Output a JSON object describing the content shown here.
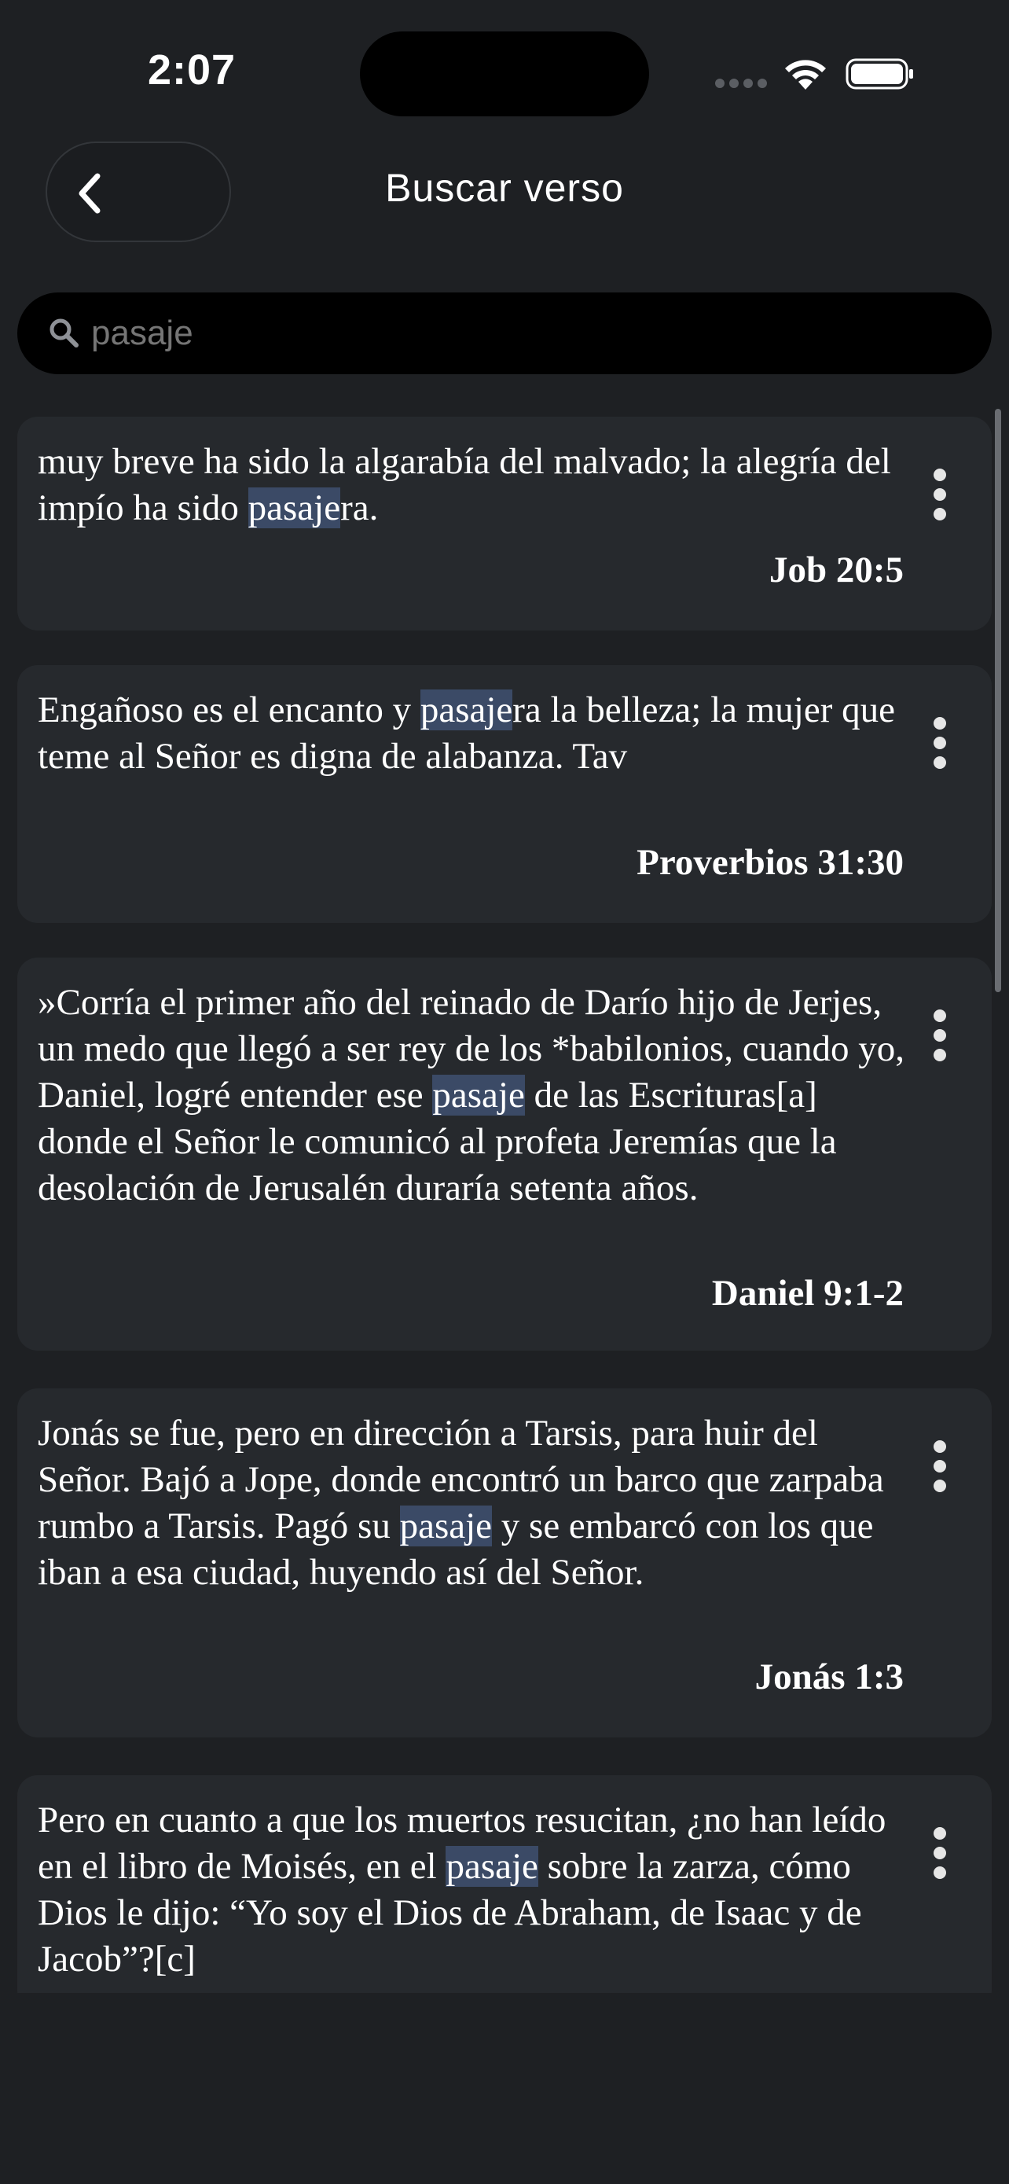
{
  "status_bar": {
    "time": "2:07"
  },
  "header": {
    "title": "Buscar verso"
  },
  "search": {
    "value": "",
    "placeholder": "pasaje"
  },
  "colors": {
    "background": "#1e2023",
    "card": "#26292d",
    "highlight": "#3b4a66",
    "search_bg": "#000000"
  },
  "icons": {
    "back": "chevron-left-icon",
    "search": "magnifier-icon",
    "more": "vertical-ellipsis-icon"
  },
  "results": [
    {
      "before": "muy breve ha sido la algarabía del malvado;    la alegría del impío ha sido ",
      "match": "pasaje",
      "after": "ra.",
      "reference": "Job 20:5"
    },
    {
      "before": "Engañoso es el encanto y ",
      "match": "pasaje",
      "after": "ra la belleza;    la mujer que teme al Señor es digna de alabanza. Tav",
      "reference": "Proverbios 31:30"
    },
    {
      "before": "»Corría el primer año del reinado de Darío hijo de Jerjes, un medo que llegó a ser rey de los *babilonios, cuando yo, Daniel, logré entender ese ",
      "match": "pasaje",
      "after": " de las Escrituras[a] donde el Señor le comunicó al profeta Jeremías que la desolación de Jerusalén duraría setenta años.",
      "reference": "Daniel 9:1-2"
    },
    {
      "before": "Jonás se fue, pero en dirección a Tarsis, para huir del Señor. Bajó a Jope, donde encontró un barco que zarpaba rumbo a Tarsis. Pagó su ",
      "match": "pasaje",
      "after": " y se embarcó con los que iban a esa ciudad, huyendo así del Señor.",
      "reference": "Jonás 1:3"
    },
    {
      "before": "Pero en cuanto a que los muertos resucitan, ¿no han leído en el libro de Moisés, en el ",
      "match": "pasaje",
      "after": " sobre la zarza, cómo Dios le dijo: “Yo soy el Dios de Abraham, de Isaac y de Jacob”?[c]",
      "reference": ""
    }
  ]
}
